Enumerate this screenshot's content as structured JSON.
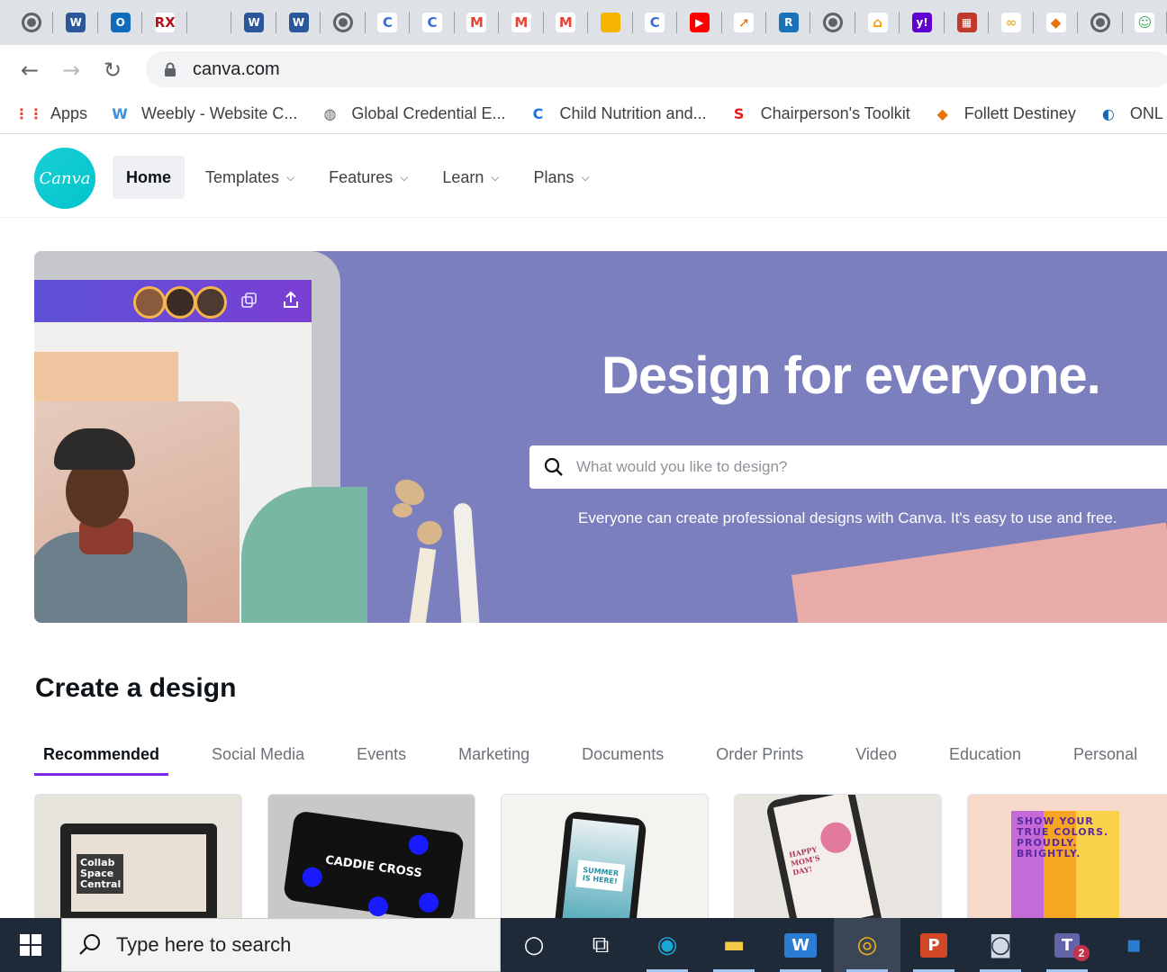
{
  "browser": {
    "tabs": [
      {
        "icon": "globe-icon",
        "glyph": "",
        "color": "#5f6368"
      },
      {
        "icon": "word-icon",
        "glyph": "W",
        "color": "#2b579a"
      },
      {
        "icon": "outlook-icon",
        "glyph": "O",
        "color": "#0f6cbd"
      },
      {
        "icon": "rx-icon",
        "glyph": "RX",
        "color": "#b3121b"
      },
      {
        "icon": "blank-tab-icon",
        "glyph": "",
        "color": "#dee1e6"
      },
      {
        "icon": "word-icon",
        "glyph": "W",
        "color": "#2b579a"
      },
      {
        "icon": "word-icon",
        "glyph": "W",
        "color": "#2b579a"
      },
      {
        "icon": "globe-icon",
        "glyph": "",
        "color": "#5f6368"
      },
      {
        "icon": "classlink-icon",
        "glyph": "C",
        "color": "#3a6cd8"
      },
      {
        "icon": "classlink-icon",
        "glyph": "C",
        "color": "#3a6cd8"
      },
      {
        "icon": "gmail-icon",
        "glyph": "M",
        "color": "#ea4335"
      },
      {
        "icon": "gmail-icon",
        "glyph": "M",
        "color": "#ea4335"
      },
      {
        "icon": "gmail-icon",
        "glyph": "M",
        "color": "#ea4335"
      },
      {
        "icon": "slides-icon",
        "glyph": "",
        "color": "#f4b400"
      },
      {
        "icon": "classlink-icon",
        "glyph": "C",
        "color": "#3a6cd8"
      },
      {
        "icon": "youtube-icon",
        "glyph": "▶",
        "color": "#ff0000"
      },
      {
        "icon": "rocket-icon",
        "glyph": "➚",
        "color": "#e8710a"
      },
      {
        "icon": "r-icon",
        "glyph": "R",
        "color": "#1a73b8"
      },
      {
        "icon": "globe-icon",
        "glyph": "",
        "color": "#5f6368"
      },
      {
        "icon": "home-icon",
        "glyph": "⌂",
        "color": "#f29900"
      },
      {
        "icon": "yahoo-icon",
        "glyph": "y!",
        "color": "#5f01d1"
      },
      {
        "icon": "pixel-icon",
        "glyph": "▦",
        "color": "#c0392b"
      },
      {
        "icon": "link-icon",
        "glyph": "∞",
        "color": "#e5b53b"
      },
      {
        "icon": "destiny-icon",
        "glyph": "◆",
        "color": "#e8710a"
      },
      {
        "icon": "globe-icon",
        "glyph": "",
        "color": "#5f6368"
      },
      {
        "icon": "frog-icon",
        "glyph": "☺",
        "color": "#34a853"
      }
    ],
    "url": "canva.com",
    "bookmarks": [
      {
        "icon": "apps-grid-icon",
        "label": "Apps",
        "glyph": "⋮⋮",
        "color": "#ea4335"
      },
      {
        "icon": "weebly-icon",
        "label": "Weebly - Website C...",
        "glyph": "W",
        "color": "#3b8fe0"
      },
      {
        "icon": "globe-icon",
        "label": "Global Credential E...",
        "glyph": "◍",
        "color": "#5f6368"
      },
      {
        "icon": "classlink-icon",
        "label": "Child Nutrition and...",
        "glyph": "C",
        "color": "#1a73e8"
      },
      {
        "icon": "s-icon",
        "label": "Chairperson's Toolkit",
        "glyph": "S",
        "color": "#e11d1d"
      },
      {
        "icon": "destiny-icon",
        "label": "Follett Destiney",
        "glyph": "◆",
        "color": "#e8710a"
      },
      {
        "icon": "onl-icon",
        "label": "ONL",
        "glyph": "◐",
        "color": "#1468b5"
      }
    ]
  },
  "site": {
    "logo_text": "Canva",
    "nav": [
      {
        "label": "Home",
        "active": true,
        "dropdown": false
      },
      {
        "label": "Templates",
        "active": false,
        "dropdown": true
      },
      {
        "label": "Features",
        "active": false,
        "dropdown": true
      },
      {
        "label": "Learn",
        "active": false,
        "dropdown": true
      },
      {
        "label": "Plans",
        "active": false,
        "dropdown": true
      }
    ]
  },
  "hero": {
    "headline": "Design for everyone.",
    "search_placeholder": "What would you like to design?",
    "subtext": "Everyone can create professional designs with Canva. It's easy to use and free."
  },
  "create": {
    "title": "Create a design",
    "tabs": [
      "Recommended",
      "Social Media",
      "Events",
      "Marketing",
      "Documents",
      "Order Prints",
      "Video",
      "Education",
      "Personal"
    ],
    "active_tab": "Recommended",
    "cards": [
      {
        "name": "presentation-card",
        "text": "Collab Space Central",
        "bg": "#e6e2dc"
      },
      {
        "name": "video-card",
        "text": "CADDIE CROSS",
        "bg": "#c9c8c6"
      },
      {
        "name": "instagram-post-card",
        "text": "SUMMER IS HERE!",
        "bg": "#f5f3f0"
      },
      {
        "name": "poster-card",
        "text": "HAPPY MOM'S DAY!",
        "bg": "#e9e6e1"
      },
      {
        "name": "flyer-card",
        "text": "SHOW YOUR TRUE COLORS. PROUDLY. BRIGHTLY.",
        "bg": "#f6d9c9"
      }
    ]
  },
  "taskbar": {
    "search_placeholder": "Type here to search",
    "apps": [
      {
        "icon": "cortana-icon",
        "glyph": "○"
      },
      {
        "icon": "task-view-icon",
        "glyph": "⧉"
      },
      {
        "icon": "edge-icon",
        "glyph": "◉"
      },
      {
        "icon": "file-explorer-icon",
        "glyph": "▬"
      },
      {
        "icon": "word-icon",
        "glyph": "W"
      },
      {
        "icon": "chrome-icon",
        "glyph": "◎"
      },
      {
        "icon": "powerpoint-icon",
        "glyph": "P"
      },
      {
        "icon": "camera-icon",
        "glyph": "◙"
      },
      {
        "icon": "teams-icon",
        "glyph": "T"
      },
      {
        "icon": "more-app-icon",
        "glyph": "▪"
      }
    ],
    "teams_badge": "2"
  }
}
